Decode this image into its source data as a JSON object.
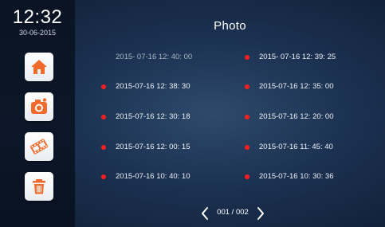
{
  "clock": {
    "time": "12:32",
    "date": "30-06-2015"
  },
  "sidebar": {
    "items": [
      {
        "icon": "home-icon",
        "color": "#f26b2d"
      },
      {
        "icon": "camera-icon",
        "color": "#f26b2d"
      },
      {
        "icon": "film-icon",
        "color": "#f26b2d"
      },
      {
        "icon": "trash-icon",
        "color": "#f26b2d"
      }
    ]
  },
  "title": "Photo",
  "photos": [
    {
      "label": "2015- 07-16  12: 40: 00",
      "unread": false
    },
    {
      "label": "2015- 07-16  12: 39: 25",
      "unread": true
    },
    {
      "label": "2015-07-16  12: 38: 30",
      "unread": true
    },
    {
      "label": "2015-07-16  12: 35: 00",
      "unread": true
    },
    {
      "label": "2015-07-16  12: 30: 18",
      "unread": true
    },
    {
      "label": "2015-07-16  12: 20: 00",
      "unread": true
    },
    {
      "label": "2015-07-16  12: 00: 15",
      "unread": true
    },
    {
      "label": "2015-07-16  11: 45: 40",
      "unread": true
    },
    {
      "label": "2015-07-16  10: 40: 10",
      "unread": true
    },
    {
      "label": "2015-07-16  10: 30: 36",
      "unread": true
    }
  ],
  "pager": {
    "current": "001",
    "separator": "/",
    "total": "002",
    "prev_icon": "chevron-left-icon",
    "next_icon": "chevron-right-icon"
  },
  "colors": {
    "unread_dot": "#ff1e1e",
    "accent": "#f26b2d"
  }
}
